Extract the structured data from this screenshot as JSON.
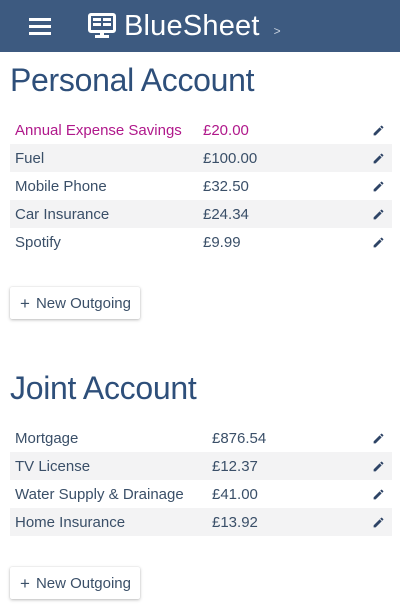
{
  "header": {
    "brand": "BlueSheet",
    "caret": ">"
  },
  "accounts": [
    {
      "title": "Personal Account",
      "new_button_label": "New Outgoing",
      "items": [
        {
          "name": "Annual Expense Savings",
          "amount": "£20.00",
          "highlight": true
        },
        {
          "name": "Fuel",
          "amount": "£100.00"
        },
        {
          "name": "Mobile Phone",
          "amount": "£32.50"
        },
        {
          "name": "Car Insurance",
          "amount": "£24.34"
        },
        {
          "name": "Spotify",
          "amount": "£9.99"
        }
      ]
    },
    {
      "title": "Joint Account",
      "new_button_label": "New Outgoing",
      "items": [
        {
          "name": "Mortgage",
          "amount": "£876.54"
        },
        {
          "name": "TV License",
          "amount": "£12.37"
        },
        {
          "name": "Water Supply & Drainage",
          "amount": "£41.00"
        },
        {
          "name": "Home Insurance",
          "amount": "£13.92"
        }
      ]
    }
  ],
  "icons": {
    "menu": "hamburger-menu-icon",
    "brand": "monitor-sheet-icon",
    "edit": "pencil-icon",
    "add": "plus-icon"
  },
  "colors": {
    "navbar": "#3d5a80",
    "title": "#2e4f7a",
    "highlight_row": "#b0188b",
    "edit_icon": "#2e4466"
  }
}
